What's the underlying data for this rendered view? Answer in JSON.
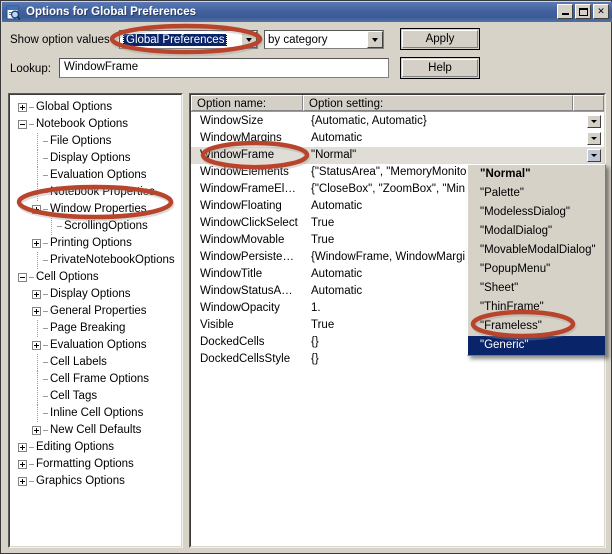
{
  "window": {
    "title": "Options for Global Preferences",
    "icon": "options-magnifier-icon",
    "minimize_label": "Minimize",
    "maximize_label": "Maximize",
    "close_label": "✕"
  },
  "form": {
    "show_option_values_label": "Show option values",
    "scope_value": "Global Preferences",
    "grouping_value": "by category",
    "apply_label": "Apply",
    "lookup_label": "Lookup:",
    "lookup_value": "WindowFrame",
    "help_label": "Help"
  },
  "tree": {
    "items": [
      {
        "label": "Global Options",
        "depth": 0,
        "toggle": "plus"
      },
      {
        "label": "Notebook Options",
        "depth": 0,
        "toggle": "minus"
      },
      {
        "label": "File Options",
        "depth": 1,
        "toggle": "none"
      },
      {
        "label": "Display Options",
        "depth": 1,
        "toggle": "none"
      },
      {
        "label": "Evaluation Options",
        "depth": 1,
        "toggle": "none"
      },
      {
        "label": "Notebook Properties",
        "depth": 1,
        "toggle": "none"
      },
      {
        "label": "Window Properties",
        "depth": 1,
        "toggle": "plus"
      },
      {
        "label": "ScrollingOptions",
        "depth": 2,
        "toggle": "none"
      },
      {
        "label": "Printing Options",
        "depth": 1,
        "toggle": "plus"
      },
      {
        "label": "PrivateNotebookOptions",
        "depth": 1,
        "toggle": "none"
      },
      {
        "label": "Cell Options",
        "depth": 0,
        "toggle": "minus"
      },
      {
        "label": "Display Options",
        "depth": 1,
        "toggle": "plus"
      },
      {
        "label": "General Properties",
        "depth": 1,
        "toggle": "plus"
      },
      {
        "label": "Page Breaking",
        "depth": 1,
        "toggle": "none"
      },
      {
        "label": "Evaluation Options",
        "depth": 1,
        "toggle": "plus"
      },
      {
        "label": "Cell Labels",
        "depth": 1,
        "toggle": "none"
      },
      {
        "label": "Cell Frame Options",
        "depth": 1,
        "toggle": "none"
      },
      {
        "label": "Cell Tags",
        "depth": 1,
        "toggle": "none"
      },
      {
        "label": "Inline Cell Options",
        "depth": 1,
        "toggle": "none"
      },
      {
        "label": "New Cell Defaults",
        "depth": 1,
        "toggle": "plus"
      },
      {
        "label": "Editing Options",
        "depth": 0,
        "toggle": "plus"
      },
      {
        "label": "Formatting Options",
        "depth": 0,
        "toggle": "plus"
      },
      {
        "label": "Graphics Options",
        "depth": 0,
        "toggle": "plus"
      }
    ]
  },
  "list": {
    "header_name": "Option name:",
    "header_setting": "Option setting:",
    "rows": [
      {
        "name": "WindowSize",
        "value": "{Automatic, Automatic}",
        "button": true,
        "selected": false
      },
      {
        "name": "WindowMargins",
        "value": "Automatic",
        "button": true,
        "selected": false
      },
      {
        "name": "WindowFrame",
        "value": "\"Normal\"",
        "button": true,
        "selected": true
      },
      {
        "name": "WindowElements",
        "value": "{\"StatusArea\", \"MemoryMonitor\"",
        "button": false,
        "selected": false
      },
      {
        "name": "WindowFrameEl…",
        "value": "{\"CloseBox\", \"ZoomBox\", \"Min",
        "button": false,
        "selected": false
      },
      {
        "name": "WindowFloating",
        "value": "Automatic",
        "button": false,
        "selected": false
      },
      {
        "name": "WindowClickSelect",
        "value": "True",
        "button": false,
        "selected": false
      },
      {
        "name": "WindowMovable",
        "value": "True",
        "button": false,
        "selected": false
      },
      {
        "name": "WindowPersiste…",
        "value": "{WindowFrame, WindowMargi",
        "button": false,
        "selected": false
      },
      {
        "name": "WindowTitle",
        "value": "Automatic",
        "button": false,
        "selected": false
      },
      {
        "name": "WindowStatusA…",
        "value": "Automatic",
        "button": false,
        "selected": false
      },
      {
        "name": "WindowOpacity",
        "value": "1.",
        "button": false,
        "selected": false
      },
      {
        "name": "Visible",
        "value": "True",
        "button": false,
        "selected": false
      },
      {
        "name": "DockedCells",
        "value": "{}",
        "button": false,
        "selected": false
      },
      {
        "name": "DockedCellsStyle",
        "value": "{}",
        "button": false,
        "selected": false
      }
    ]
  },
  "dropdown": {
    "items": [
      {
        "label": "\"Normal\"",
        "bold": true,
        "highlighted": false
      },
      {
        "label": "\"Palette\"",
        "bold": false,
        "highlighted": false
      },
      {
        "label": "\"ModelessDialog\"",
        "bold": false,
        "highlighted": false
      },
      {
        "label": "\"ModalDialog\"",
        "bold": false,
        "highlighted": false
      },
      {
        "label": "\"MovableModalDialog\"",
        "bold": false,
        "highlighted": false
      },
      {
        "label": "\"PopupMenu\"",
        "bold": false,
        "highlighted": false
      },
      {
        "label": "\"Sheet\"",
        "bold": false,
        "highlighted": false
      },
      {
        "label": "\"ThinFrame\"",
        "bold": false,
        "highlighted": false
      },
      {
        "label": "\"Frameless\"",
        "bold": false,
        "highlighted": false
      },
      {
        "label": "\"Generic\"",
        "bold": false,
        "highlighted": true
      }
    ]
  },
  "annotations": {
    "color": "#b8442c",
    "marks": [
      {
        "name": "scope-combo-highlight"
      },
      {
        "name": "window-properties-highlight"
      },
      {
        "name": "windowframe-row-highlight"
      },
      {
        "name": "generic-option-highlight"
      }
    ]
  }
}
